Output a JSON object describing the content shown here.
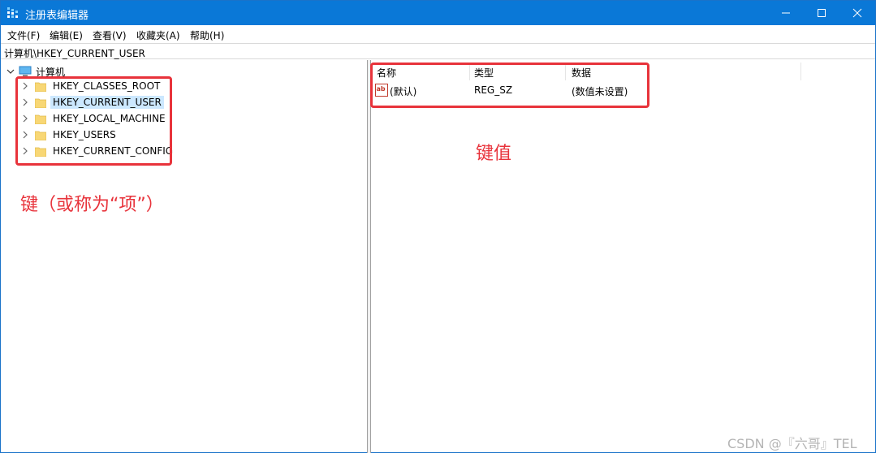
{
  "window": {
    "title": "注册表编辑器",
    "accent_color": "#0a78d7",
    "controls": {
      "minimize_icon": "minimize-icon",
      "maximize_icon": "maximize-icon",
      "close_icon": "close-icon"
    }
  },
  "menu": [
    "文件(F)",
    "编辑(E)",
    "查看(V)",
    "收藏夹(A)",
    "帮助(H)"
  ],
  "address": "计算机\\HKEY_CURRENT_USER",
  "tree": {
    "root": "计算机",
    "nodes": [
      {
        "label": "HKEY_CLASSES_ROOT",
        "selected": false
      },
      {
        "label": "HKEY_CURRENT_USER",
        "selected": true
      },
      {
        "label": "HKEY_LOCAL_MACHINE",
        "selected": false
      },
      {
        "label": "HKEY_USERS",
        "selected": false
      },
      {
        "label": "HKEY_CURRENT_CONFIG",
        "selected": false
      }
    ]
  },
  "list": {
    "columns": [
      "名称",
      "类型",
      "数据"
    ],
    "rows": [
      {
        "name": "(默认)",
        "type": "REG_SZ",
        "data": "(数值未设置)",
        "icon": "string-value-icon"
      }
    ]
  },
  "annotations": {
    "color": "#e8333b",
    "key_label": "键（或称为“项”）",
    "value_label": "键值"
  },
  "watermark": "CSDN @『六哥』TEL"
}
